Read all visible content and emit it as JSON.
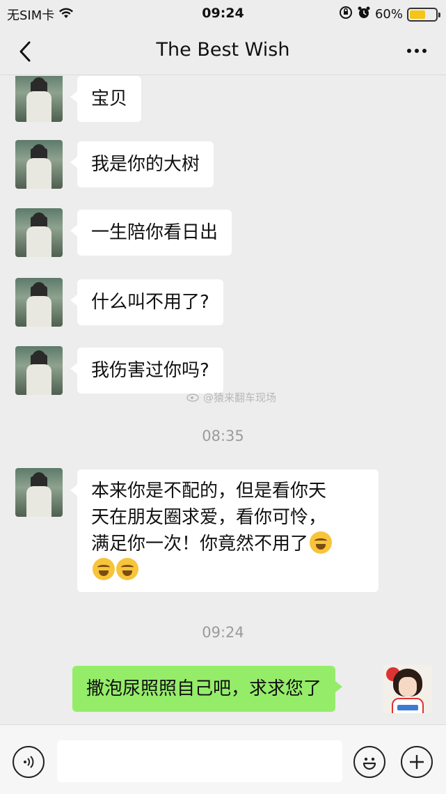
{
  "status_bar": {
    "carrier": "无SIM卡",
    "time": "09:24",
    "battery": "60%",
    "battery_level": 0.6,
    "icons": [
      "wifi-icon",
      "rotation-lock-icon",
      "alarm-icon",
      "battery-icon"
    ]
  },
  "header": {
    "title": "The Best Wish",
    "back_icon": "chevron-left-icon",
    "more_icon": "more-dots-icon"
  },
  "messages": [
    {
      "side": "left",
      "text": "宝贝"
    },
    {
      "side": "left",
      "text": "我是你的大树"
    },
    {
      "side": "left",
      "text": "一生陪你看日出"
    },
    {
      "side": "left",
      "text": "什么叫不用了?"
    },
    {
      "side": "left",
      "text": "我伤害过你吗?"
    },
    {
      "type": "timestamp",
      "text": "08:35"
    },
    {
      "side": "left",
      "lines": [
        "本来你是不配的，但是看你天",
        "天在朋友圈求爱，看你可怜，",
        "满足你一次！你竟然不用了"
      ],
      "emoji": "laugh-cry-emoji"
    },
    {
      "type": "timestamp",
      "text": "09:24"
    },
    {
      "side": "right",
      "text": "撒泡尿照照自己吧，求求您了"
    }
  ],
  "watermark": "@猿来翻车现场",
  "input_bar": {
    "voice_icon": "voice-icon",
    "emoji_icon": "emoji-icon",
    "plus_icon": "plus-icon",
    "placeholder": ""
  },
  "colors": {
    "background": "#ededed",
    "incoming_bubble": "#ffffff",
    "outgoing_bubble": "#95ec69",
    "timestamp": "#9b9b9b"
  }
}
